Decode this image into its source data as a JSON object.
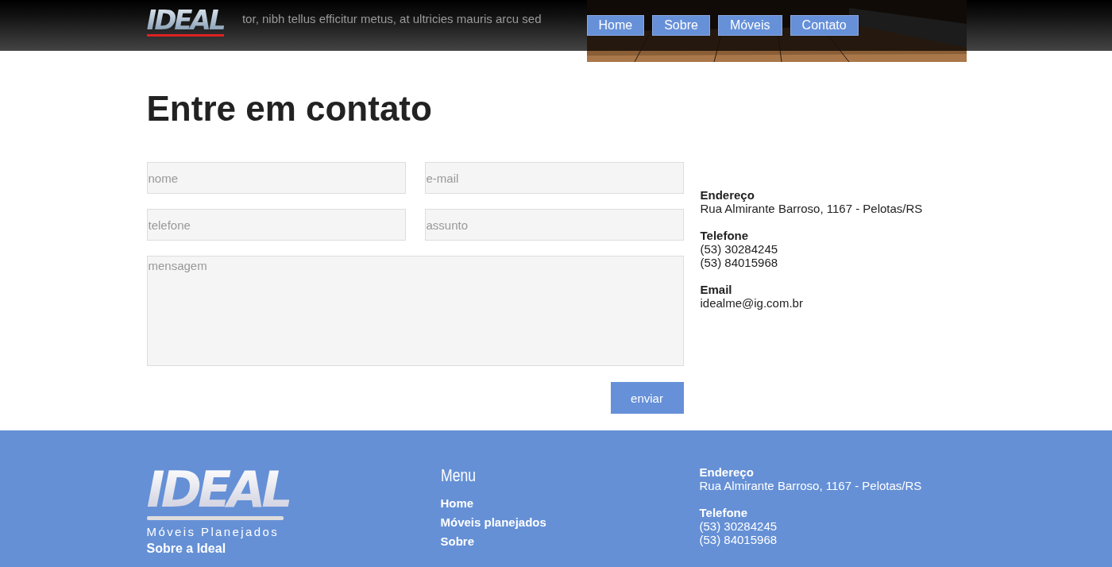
{
  "header": {
    "background_text": "tor, nibh tellus efficitur metus, at ultricies mauris arcu sed",
    "logo": "IDEAL",
    "nav": [
      {
        "label": "Home"
      },
      {
        "label": "Sobre"
      },
      {
        "label": "Móveis"
      },
      {
        "label": "Contato"
      }
    ]
  },
  "page_title": "Entre em contato",
  "form": {
    "fields": [
      {
        "kind": "input",
        "placeholder": "nome"
      },
      {
        "kind": "input",
        "placeholder": "e-mail"
      },
      {
        "kind": "input",
        "placeholder": "telefone"
      },
      {
        "kind": "input",
        "placeholder": "assunto"
      },
      {
        "kind": "textarea",
        "placeholder": "mensagem"
      }
    ],
    "submit": "enviar"
  },
  "contact": [
    {
      "label": "Endereço",
      "lines": [
        "Rua Almirante Barroso, 1167 - Pelotas/RS"
      ]
    },
    {
      "label": "Telefone",
      "lines": [
        "(53) 30284245",
        "(53) 84015968"
      ]
    },
    {
      "label": "Email",
      "lines": [
        "idealme@ig.com.br"
      ]
    }
  ],
  "footer": {
    "logo": "IDEAL",
    "tagline": "Móveis Planejados",
    "about_heading": "Sobre a Ideal",
    "menu_title": "Menu",
    "menu": [
      "Home",
      "Móveis planejados",
      "Sobre"
    ],
    "contact": [
      {
        "label": "Endereço",
        "lines": [
          "Rua Almirante Barroso, 1167 - Pelotas/RS"
        ]
      },
      {
        "label": "Telefone",
        "lines": [
          "(53) 30284245",
          "(53) 84015968"
        ]
      }
    ]
  }
}
